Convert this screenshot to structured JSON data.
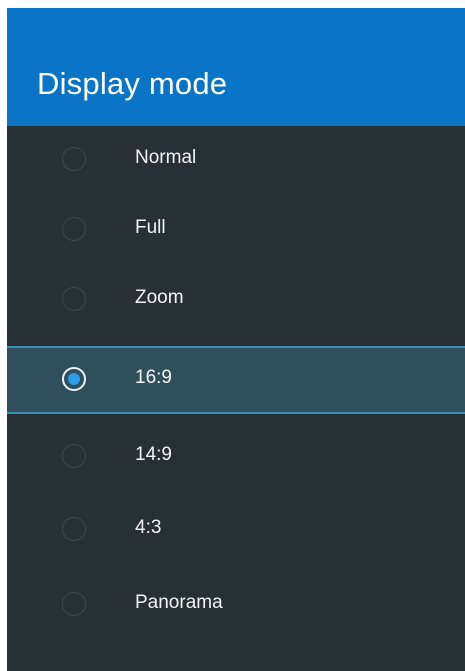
{
  "dialog": {
    "title": "Display mode"
  },
  "options": [
    {
      "label": "Normal",
      "selected": false
    },
    {
      "label": "Full",
      "selected": false
    },
    {
      "label": "Zoom",
      "selected": false
    },
    {
      "label": "16:9",
      "selected": true
    },
    {
      "label": "14:9",
      "selected": false
    },
    {
      "label": "4:3",
      "selected": false
    },
    {
      "label": "Panorama",
      "selected": false
    }
  ],
  "colors": {
    "header": "#0a74c6",
    "background": "#263035",
    "selected_row": "#2f4f5c",
    "selected_border": "#3e8db3",
    "radio_selected": "#2a9ee8",
    "text": "#f2f4f5"
  }
}
